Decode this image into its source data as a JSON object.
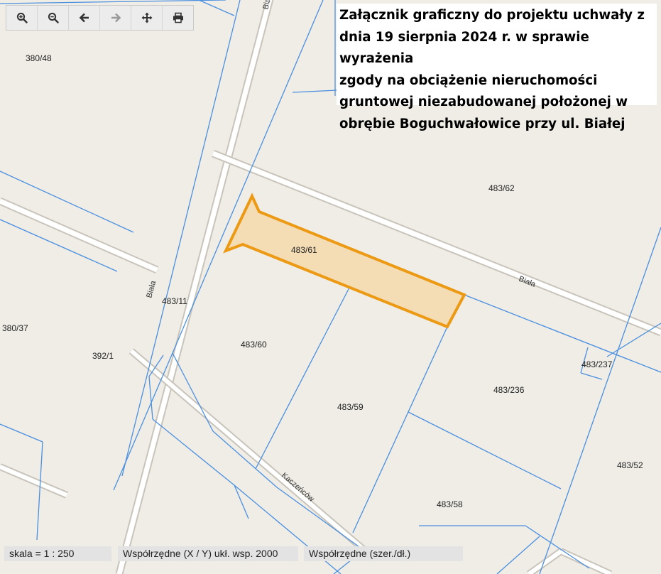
{
  "toolbar": {
    "buttons": [
      {
        "name": "zoom-in-button",
        "icon": "zoom-in-icon"
      },
      {
        "name": "zoom-out-button",
        "icon": "zoom-out-icon"
      },
      {
        "name": "back-button",
        "icon": "arrow-left-icon"
      },
      {
        "name": "forward-button",
        "icon": "arrow-right-icon",
        "disabled": true
      },
      {
        "name": "pan-button",
        "icon": "move-icon"
      },
      {
        "name": "print-button",
        "icon": "printer-icon"
      }
    ]
  },
  "title": {
    "line1": "Załącznik graficzny do projektu uchwały z",
    "line2": "dnia 19 sierpnia 2024 r. w sprawie wyrażenia",
    "line3": "zgody na obciążenie nieruchomości",
    "line4": "gruntowej niezabudowanej położonej w",
    "line5": "obrębie Boguchwałowice przy ul. Białej"
  },
  "parcels": {
    "p380_48": "380/48",
    "p483_62": "483/62",
    "p483_61": "483/61",
    "p483_11": "483/11",
    "p380_37": "380/37",
    "p392_1": "392/1",
    "p483_60": "483/60",
    "p483_237": "483/237",
    "p483_236": "483/236",
    "p483_59": "483/59",
    "p483_52": "483/52",
    "p483_58": "483/58"
  },
  "streets": {
    "biala_top": "Biała",
    "biala_east": "Biała",
    "biala_west": "Biała",
    "kaczencow": "Kaczeńców"
  },
  "status": {
    "scale": "skala = 1 : 250",
    "coords_xy": "Współrzędne (X / Y) ukł. wsp. 2000",
    "coords_latlon": "Współrzędne (szer./dł.)"
  },
  "colors": {
    "background": "#efede6",
    "parcel_boundary": "#4a8fe0",
    "highlight_outline": "#ec9a13",
    "highlight_fill": "#f4dcb4",
    "road_edge": "#c9c4bb",
    "road_fill": "#ffffff"
  }
}
